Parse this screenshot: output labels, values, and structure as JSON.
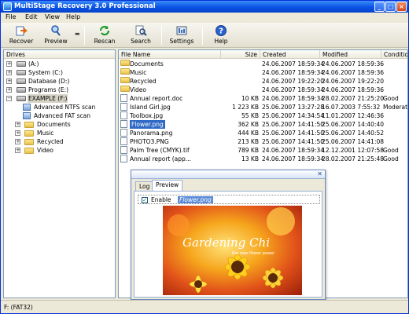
{
  "window": {
    "title": "MultiStage Recovery 3.0 Professional"
  },
  "menu": [
    "File",
    "Edit",
    "View",
    "Help"
  ],
  "toolbar": {
    "recover": "Recover",
    "preview": "Preview",
    "rescan": "Rescan",
    "search": "Search",
    "settings": "Settings",
    "help": "Help"
  },
  "drives": {
    "header": "Drives",
    "items": [
      {
        "label": "(A:)"
      },
      {
        "label": "System (C:)"
      },
      {
        "label": "Database (D:)"
      },
      {
        "label": "Programs (E:)"
      },
      {
        "label": "EXAMPLE (F:)"
      },
      {
        "label": "Advanced NTFS scan"
      },
      {
        "label": "Advanced FAT scan"
      },
      {
        "label": "Documents"
      },
      {
        "label": "Music"
      },
      {
        "label": "Recycled"
      },
      {
        "label": "Video"
      }
    ]
  },
  "files": {
    "headers": {
      "name": "File Name",
      "size": "Size",
      "created": "Created",
      "modified": "Modified",
      "condition": "Condition"
    },
    "rows": [
      {
        "name": "Documents",
        "size": "",
        "created": "24.06.2007 18:59:34",
        "modified": "24.06.2007 18:59:36",
        "condition": ""
      },
      {
        "name": "Music",
        "size": "",
        "created": "24.06.2007 18:59:34",
        "modified": "24.06.2007 18:59:36",
        "condition": ""
      },
      {
        "name": "Recycled",
        "size": "",
        "created": "24.06.2007 19:22:20",
        "modified": "24.06.2007 19:22:20",
        "condition": ""
      },
      {
        "name": "Video",
        "size": "",
        "created": "24.06.2007 18:59:34",
        "modified": "24.06.2007 18:59:36",
        "condition": ""
      },
      {
        "name": "Annual report.doc",
        "size": "10 KB",
        "created": "24.06.2007 18:59:34",
        "modified": "28.02.2007 21:25:20",
        "condition": "Good"
      },
      {
        "name": "Island Girl.jpg",
        "size": "1 223 KB",
        "created": "25.06.2007 13:27:28",
        "modified": "16.07.2003 7:55:32",
        "condition": "Moderate"
      },
      {
        "name": "Toolbox.jpg",
        "size": "55 KB",
        "created": "25.06.2007 14:34:54",
        "modified": "11.01.2007 12:46:36",
        "condition": ""
      },
      {
        "name": "Flower.png",
        "size": "362 KB",
        "created": "25.06.2007 14:41:50",
        "modified": "25.06.2007 14:40:40",
        "condition": ""
      },
      {
        "name": "Panorama.png",
        "size": "444 KB",
        "created": "25.06.2007 14:41:50",
        "modified": "25.06.2007 14:40:52",
        "condition": ""
      },
      {
        "name": "PHOTO3.PNG",
        "size": "213 KB",
        "created": "25.06.2007 14:41:50",
        "modified": "25.06.2007 14:41:08",
        "condition": ""
      },
      {
        "name": "Palm Tree (CMYK).tif",
        "size": "789 KB",
        "created": "24.06.2007 18:59:34",
        "modified": "12.12.2001 12:07:58",
        "condition": "Good"
      },
      {
        "name": "Annual report (app...",
        "size": "13 KB",
        "created": "24.06.2007 18:59:34",
        "modified": "28.02.2007 21:25:48",
        "condition": "Good"
      }
    ]
  },
  "preview_panel": {
    "tab_log": "Log",
    "tab_preview": "Preview",
    "enable_label": "Enable",
    "file_name": "Flower.png",
    "image_title": "Gardening Chi",
    "image_subtitle": "the new flower power"
  },
  "status": {
    "text": "F: (FAT32)"
  }
}
